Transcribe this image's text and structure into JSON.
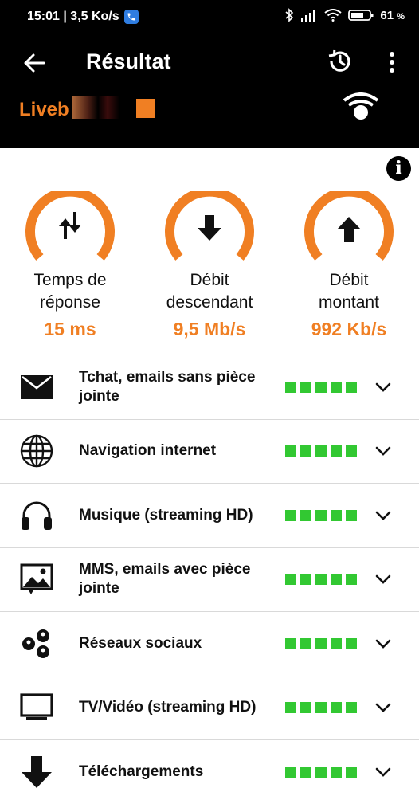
{
  "status_bar": {
    "time_speed": "15:01 | 3,5 Ko/s",
    "battery": "61",
    "battery_unit": "%"
  },
  "app_bar": {
    "title": "Résultat",
    "network_name": "Liveb"
  },
  "gauges": [
    {
      "label_line1": "Temps de",
      "label_line2": "réponse",
      "value": "15 ms",
      "icon": "up-down-arrows-icon"
    },
    {
      "label_line1": "Débit",
      "label_line2": "descendant",
      "value": "9,5 Mb/s",
      "icon": "download-arrow-icon"
    },
    {
      "label_line1": "Débit",
      "label_line2": "montant",
      "value": "992 Kb/s",
      "icon": "upload-arrow-icon"
    }
  ],
  "usages": [
    {
      "label": "Tchat, emails sans pièce jointe",
      "icon": "envelope-icon",
      "rating": 5
    },
    {
      "label": "Navigation internet",
      "icon": "globe-icon",
      "rating": 5
    },
    {
      "label": "Musique (streaming HD)",
      "icon": "headphones-icon",
      "rating": 5
    },
    {
      "label": "MMS, emails avec pièce jointe",
      "icon": "image-icon",
      "rating": 5
    },
    {
      "label": "Réseaux sociaux",
      "icon": "social-network-icon",
      "rating": 5
    },
    {
      "label": "TV/Vidéo (streaming HD)",
      "icon": "tv-icon",
      "rating": 5
    },
    {
      "label": "Téléchargements",
      "icon": "download-icon",
      "rating": 5
    }
  ],
  "colors": {
    "accent": "#f07f23",
    "rating_green": "#32c832",
    "header_bg": "#000000"
  }
}
